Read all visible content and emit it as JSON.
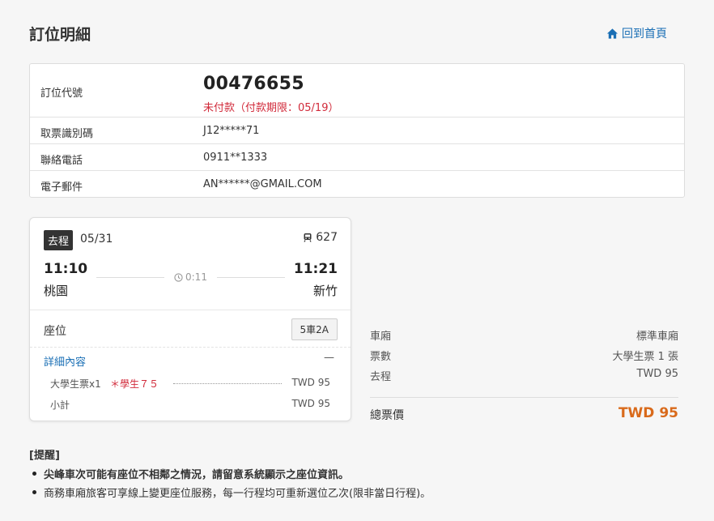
{
  "header": {
    "title": "訂位明細",
    "home_link": "回到首頁"
  },
  "booking": {
    "code_label": "訂位代號",
    "code": "00476655",
    "status": "未付款（付款期限：05/19）",
    "ticket_id_label": "取票識別碼",
    "ticket_id": "J12*****71",
    "phone_label": "聯絡電話",
    "phone": "0911**1333",
    "email_label": "電子郵件",
    "email": "AN******@GMAIL.COM"
  },
  "trip": {
    "direction": "去程",
    "date": "05/31",
    "train_number": "627",
    "depart_time": "11:10",
    "depart_station": "桃園",
    "arrive_time": "11:21",
    "arrive_station": "新竹",
    "duration": "0:11",
    "seat_label": "座位",
    "seat": "5車2A",
    "detail_label": "詳細內容",
    "collapse_symbol": "—",
    "fare_item": "大學生票x1",
    "fare_note": "＊學生７５",
    "fare_amount": "TWD 95",
    "subtotal_label": "小計",
    "subtotal": "TWD 95"
  },
  "summary": {
    "car_label": "車廂",
    "car_value": "標準車廂",
    "tickets_label": "票數",
    "tickets_value": "大學生票 1 張",
    "outbound_label": "去程",
    "outbound_value": "TWD 95",
    "total_label": "總票價",
    "total_value": "TWD 95"
  },
  "notes": {
    "title": "[提醒]",
    "items": [
      "尖峰車次可能有座位不相鄰之情況，請留意系統顯示之座位資訊。",
      "商務車廂旅客可享線上變更座位服務，每一行程均可重新選位乙次(限非當日行程)。"
    ]
  },
  "colors": {
    "link": "#1a6fb5",
    "unpaid": "#d12a3a",
    "total": "#d96a1b"
  }
}
